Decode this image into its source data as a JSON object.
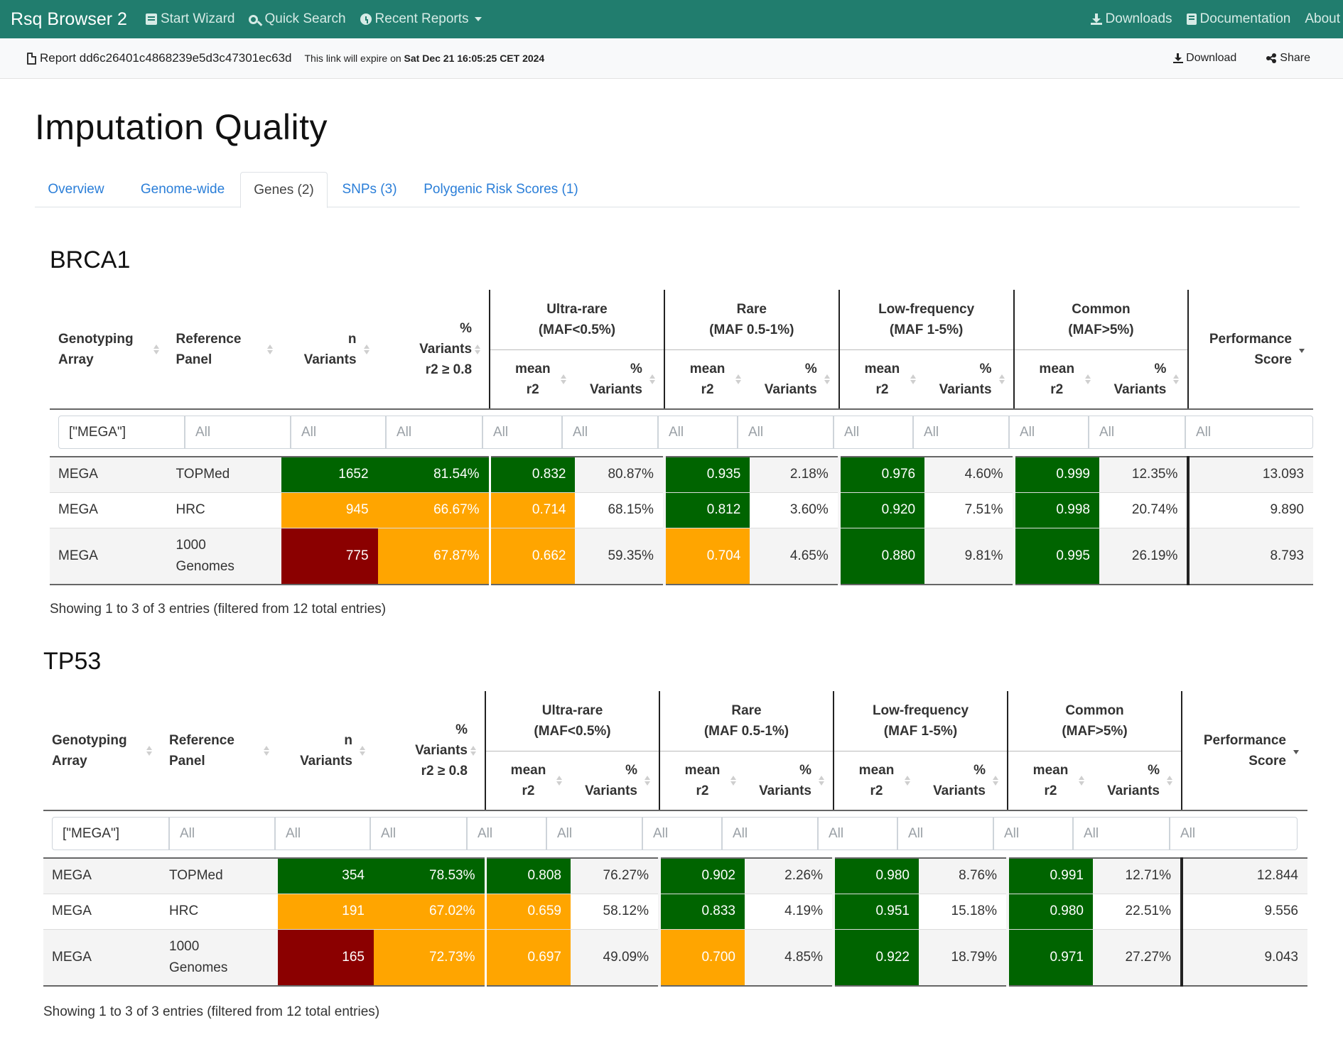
{
  "navbar": {
    "brand": "Rsq Browser 2",
    "items": [
      "Start Wizard",
      "Quick Search",
      "Recent Reports"
    ],
    "right_items": [
      "Downloads",
      "Documentation",
      "About"
    ]
  },
  "report_bar": {
    "report_label": "Report dd6c26401c4868239e5d3c47301ec63d",
    "expire_prefix": "This link will expire on",
    "expire_date": "Sat Dec 21 16:05:25 CET 2024",
    "download_label": "Download",
    "share_label": "Share"
  },
  "page_title": "Imputation Quality",
  "tabs": [
    "Overview",
    "Genome-wide",
    "Genes (2)",
    "SNPs (3)",
    "Polygenic Risk Scores (1)"
  ],
  "active_tab": "Genes (2)",
  "table_headers": {
    "genotyping_array": [
      "Genotyping",
      "Array"
    ],
    "reference_panel": [
      "Reference",
      "Panel"
    ],
    "n_variants": [
      "n",
      "Variants"
    ],
    "pct_variants_r2": [
      "%",
      "Variants",
      "r2 ≥ 0.8"
    ],
    "groups": [
      {
        "name": "Ultra-rare",
        "range": "(MAF<0.5%)"
      },
      {
        "name": "Rare",
        "range": "(MAF 0.5-1%)"
      },
      {
        "name": "Low-frequency",
        "range": "(MAF 1-5%)"
      },
      {
        "name": "Common",
        "range": "(MAF>5%)"
      }
    ],
    "mean_r2": [
      "mean",
      "r2"
    ],
    "pct_variants": [
      "%",
      "Variants"
    ],
    "performance_score": [
      "Performance",
      "Score"
    ]
  },
  "filter_values": {
    "array_filter": "[\"MEGA\"]",
    "placeholder": "All"
  },
  "colors": {
    "navbar": "#217d6e",
    "good": "#006400",
    "medium": "#ffa500",
    "poor": "#8b0000",
    "link": "#2a7ed8"
  },
  "genes": [
    {
      "name": "BRCA1",
      "rows": [
        {
          "array": "MEGA",
          "panel": "TOPMed",
          "n": "1652",
          "pct": "81.54%",
          "ur_mean": "0.832",
          "ur_pct": "80.87%",
          "rare_mean": "0.935",
          "rare_pct": "2.18%",
          "lf_mean": "0.976",
          "lf_pct": "4.60%",
          "com_mean": "0.999",
          "com_pct": "12.35%",
          "score": "13.093"
        },
        {
          "array": "MEGA",
          "panel": "HRC",
          "n": "945",
          "pct": "66.67%",
          "ur_mean": "0.714",
          "ur_pct": "68.15%",
          "rare_mean": "0.812",
          "rare_pct": "3.60%",
          "lf_mean": "0.920",
          "lf_pct": "7.51%",
          "com_mean": "0.998",
          "com_pct": "20.74%",
          "score": "9.890"
        },
        {
          "array": "MEGA",
          "panel_line1": "1000",
          "panel_line2": "Genomes",
          "n": "775",
          "pct": "67.87%",
          "ur_mean": "0.662",
          "ur_pct": "59.35%",
          "rare_mean": "0.704",
          "rare_pct": "4.65%",
          "lf_mean": "0.880",
          "lf_pct": "9.81%",
          "com_mean": "0.995",
          "com_pct": "26.19%",
          "score": "8.793"
        }
      ],
      "showing": "Showing 1 to 3 of 3 entries (filtered from 12 total entries)"
    },
    {
      "name": "TP53",
      "rows": [
        {
          "array": "MEGA",
          "panel": "TOPMed",
          "n": "354",
          "pct": "78.53%",
          "ur_mean": "0.808",
          "ur_pct": "76.27%",
          "rare_mean": "0.902",
          "rare_pct": "2.26%",
          "lf_mean": "0.980",
          "lf_pct": "8.76%",
          "com_mean": "0.991",
          "com_pct": "12.71%",
          "score": "12.844"
        },
        {
          "array": "MEGA",
          "panel": "HRC",
          "n": "191",
          "pct": "67.02%",
          "ur_mean": "0.659",
          "ur_pct": "58.12%",
          "rare_mean": "0.833",
          "rare_pct": "4.19%",
          "lf_mean": "0.951",
          "lf_pct": "15.18%",
          "com_mean": "0.980",
          "com_pct": "22.51%",
          "score": "9.556"
        },
        {
          "array": "MEGA",
          "panel_line1": "1000",
          "panel_line2": "Genomes",
          "n": "165",
          "pct": "72.73%",
          "ur_mean": "0.697",
          "ur_pct": "49.09%",
          "rare_mean": "0.700",
          "rare_pct": "4.85%",
          "lf_mean": "0.922",
          "lf_pct": "18.79%",
          "com_mean": "0.971",
          "com_pct": "27.27%",
          "score": "9.043"
        }
      ],
      "showing": "Showing 1 to 3 of 3 entries (filtered from 12 total entries)"
    }
  ]
}
